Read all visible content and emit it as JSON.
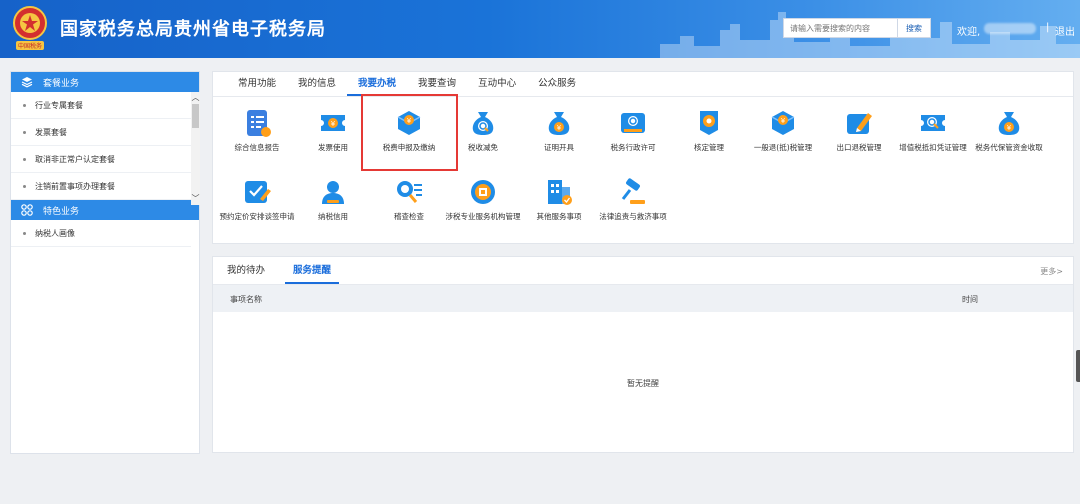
{
  "header": {
    "title": "国家税务总局贵州省电子税务局",
    "search_placeholder": "请输入需要搜索的内容",
    "search_button": "搜索",
    "welcome": "欢迎,",
    "separator": "|",
    "logout": "退出",
    "emblem_text": "中国税务"
  },
  "sidebar": {
    "sections": [
      {
        "title": "套餐业务",
        "icon": "layers-icon",
        "items": [
          "行业专属套餐",
          "发票套餐",
          "取消非正常户认定套餐",
          "注销前置事项办理套餐"
        ]
      },
      {
        "title": "特色业务",
        "icon": "grid-icon",
        "items": [
          "纳税人画像"
        ]
      }
    ]
  },
  "main": {
    "tabs": [
      "常用功能",
      "我的信息",
      "我要办税",
      "我要查询",
      "互动中心",
      "公众服务"
    ],
    "active_tab": "我要办税",
    "functions": [
      {
        "label": "综合信息报告",
        "icon": "report-icon",
        "color": "#3b7fe0"
      },
      {
        "label": "发票使用",
        "icon": "ticket-icon",
        "color": "#1f8ce6"
      },
      {
        "label": "税费申报及缴纳",
        "icon": "box-yuan-icon",
        "color": "#1f8ce6"
      },
      {
        "label": "税收减免",
        "icon": "money-bag-search-icon",
        "color": "#1f8ce6"
      },
      {
        "label": "证明开具",
        "icon": "money-bag-icon",
        "color": "#1f8ce6"
      },
      {
        "label": "税务行政许可",
        "icon": "certificate-search-icon",
        "color": "#1f8ce6"
      },
      {
        "label": "核定管理",
        "icon": "badge-gear-icon",
        "color": "#1f8ce6"
      },
      {
        "label": "一般退(抵)税管理",
        "icon": "box-yuan-icon",
        "color": "#1f8ce6"
      },
      {
        "label": "出口退税管理",
        "icon": "pencil-doc-icon",
        "color": "#1f8ce6"
      },
      {
        "label": "增值税抵扣凭证管理",
        "icon": "voucher-search-icon",
        "color": "#1f8ce6"
      },
      {
        "label": "税务代保管资金收取",
        "icon": "money-bag-icon",
        "color": "#1f8ce6"
      },
      {
        "label": "预约定价安排谈签申请",
        "icon": "checklist-icon",
        "color": "#1f8ce6"
      },
      {
        "label": "纳税信用",
        "icon": "user-icon",
        "color": "#1f8ce6"
      },
      {
        "label": "稽查检查",
        "icon": "search-list-icon",
        "color": "#1f8ce6"
      },
      {
        "label": "涉税专业服务机构管理",
        "icon": "coin-icon",
        "color": "#1f8ce6"
      },
      {
        "label": "其他服务事项",
        "icon": "building-check-icon",
        "color": "#1f8ce6"
      },
      {
        "label": "法律追责与救济事项",
        "icon": "gavel-icon",
        "color": "#1f8ce6"
      }
    ]
  },
  "service": {
    "tabs": [
      "我的待办",
      "服务提醒"
    ],
    "active_tab": "服务提醒",
    "more": "更多>",
    "columns": [
      "事项名称",
      "时间"
    ],
    "empty_text": "暂无提醒"
  },
  "colors": {
    "header": "#1a6ddb",
    "accent": "#1a6ddb",
    "sidebar_head": "#2d8ae6",
    "highlight": "#e53935"
  }
}
